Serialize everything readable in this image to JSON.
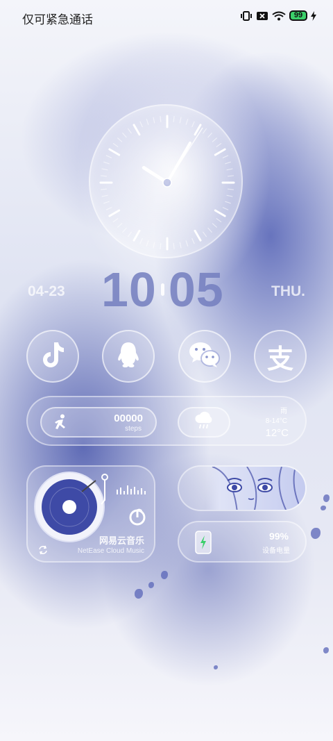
{
  "status_bar": {
    "carrier_text": "仅可紧急通话",
    "battery_level": "99",
    "icons": [
      "vibrate-icon",
      "no-sim-icon",
      "wifi-icon",
      "battery-icon",
      "charging-bolt-icon"
    ]
  },
  "clock": {
    "hour": 10,
    "minute": 5
  },
  "time_row": {
    "date": "04-23",
    "hours": "10",
    "minutes": "05",
    "weekday": "THU."
  },
  "apps": [
    {
      "name": "TikTok",
      "icon": "tiktok-icon"
    },
    {
      "name": "QQ",
      "icon": "qq-penguin-icon"
    },
    {
      "name": "WeChat",
      "icon": "wechat-icon"
    },
    {
      "name": "Alipay",
      "icon": "alipay-icon",
      "glyph": "支"
    }
  ],
  "steps_widget": {
    "value": "00000",
    "label": "steps",
    "icon": "running-icon"
  },
  "weather_widget": {
    "icon": "rain-cloud-icon",
    "description": "雨",
    "range": "8-14°C",
    "temperature": "12°C"
  },
  "music_widget": {
    "name": "网易云音乐",
    "subtitle": "NetEase Cloud Music",
    "icon": "netease-music-icon",
    "refresh_icon": "refresh-icon",
    "vinyl_icon": "vinyl-record-icon"
  },
  "image_widget": {
    "icon": "anime-portrait-image"
  },
  "battery_widget": {
    "percent": "99%",
    "label": "设备电量",
    "icon": "phone-charging-icon"
  },
  "colors": {
    "accent": "#3e4aa6",
    "charging_green": "#3bd06a",
    "glass_border": "rgba(255,255,255,0.5)"
  }
}
